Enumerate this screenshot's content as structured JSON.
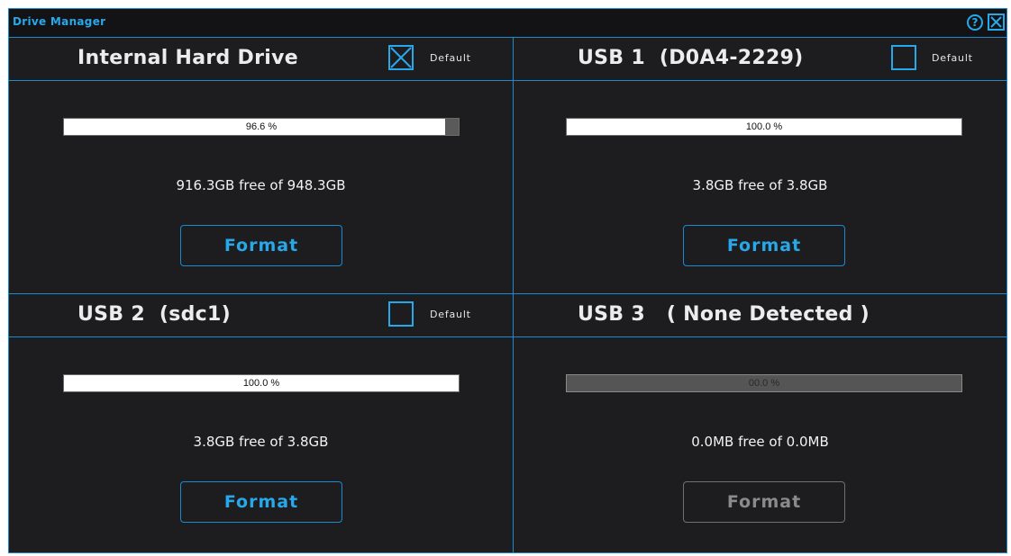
{
  "window": {
    "title": "Drive Manager",
    "help_icon": "?",
    "accent_color": "#1a8bd0"
  },
  "drives": [
    {
      "name": "Internal Hard Drive",
      "default_checked": true,
      "default_label": "Default",
      "usage_percent": 96.6,
      "usage_text": "96.6 %",
      "free_text": "916.3GB free of 948.3GB",
      "format_label": "Format",
      "format_enabled": true
    },
    {
      "name": "USB 1  (D0A4-2229)",
      "default_checked": false,
      "default_label": "Default",
      "usage_percent": 100.0,
      "usage_text": "100.0 %",
      "free_text": "3.8GB free of 3.8GB",
      "format_label": "Format",
      "format_enabled": true
    },
    {
      "name": "USB 2  (sdc1)",
      "default_checked": false,
      "default_label": "Default",
      "usage_percent": 100.0,
      "usage_text": "100.0 %",
      "free_text": "3.8GB free of 3.8GB",
      "format_label": "Format",
      "format_enabled": true
    },
    {
      "name": "USB 3   ( None Detected )",
      "usage_percent": 0.0,
      "usage_text": "00.0 %",
      "free_text": "0.0MB free of 0.0MB",
      "format_label": "Format",
      "format_enabled": false
    }
  ]
}
